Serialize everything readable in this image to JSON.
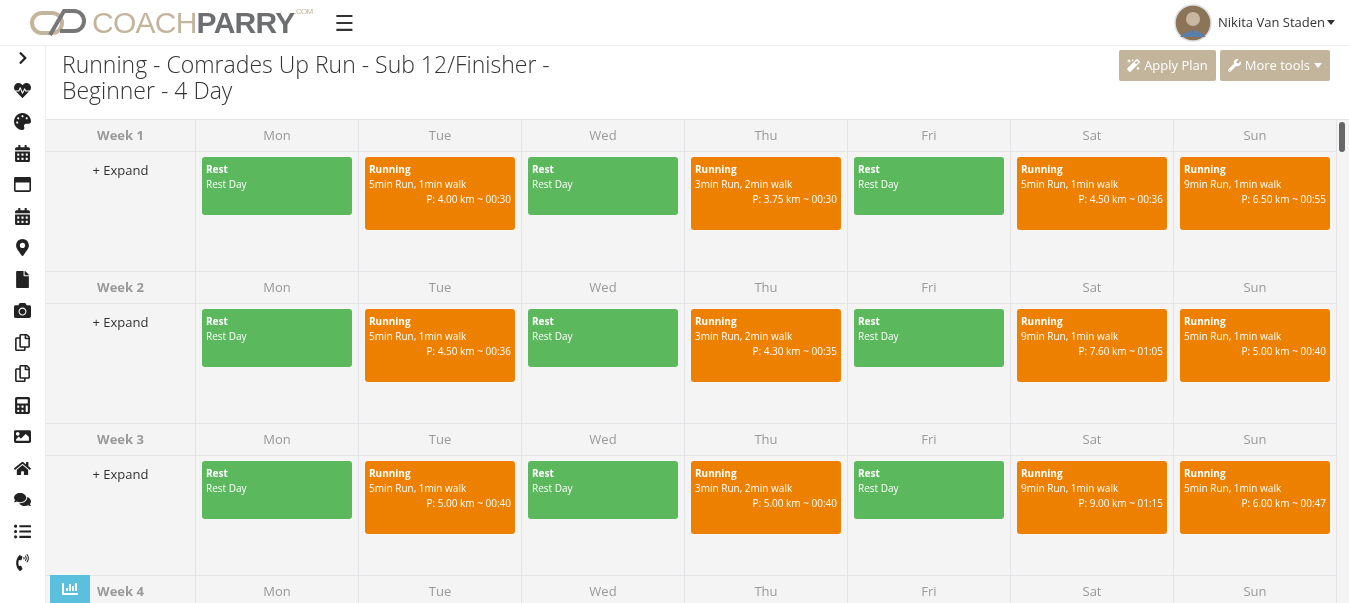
{
  "header": {
    "logo": {
      "left": "COACH",
      "right": "PARRY",
      "suffix": ".COM"
    },
    "menu_glyph": "☰",
    "user": {
      "name": "Nikita Van Staden"
    }
  },
  "plan": {
    "title": "Running - Comrades Up Run - Sub 12/Finisher - Beginner - 4 Day",
    "buttons": [
      {
        "label": "Apply Plan",
        "caret": false
      },
      {
        "label": "More tools",
        "caret": true
      }
    ]
  },
  "weeks": [
    {
      "label": "Week 1",
      "days": [
        "Mon",
        "Tue",
        "Wed",
        "Thu",
        "Fri",
        "Sat",
        "Sun"
      ],
      "expand": "+ Expand",
      "workouts": [
        {
          "kind": "rest",
          "title": "Rest",
          "detail": "Rest Day"
        },
        {
          "kind": "running",
          "title": "Running",
          "detail": "5min Run, 1min walk",
          "plan": "P: 4.00 km ~ 00:30"
        },
        {
          "kind": "rest",
          "title": "Rest",
          "detail": "Rest Day"
        },
        {
          "kind": "running",
          "title": "Running",
          "detail": "3min Run, 2min walk",
          "plan": "P: 3.75 km ~ 00:30"
        },
        {
          "kind": "rest",
          "title": "Rest",
          "detail": "Rest Day"
        },
        {
          "kind": "running",
          "title": "Running",
          "detail": "5min Run, 1min walk",
          "plan": "P: 4.50 km ~ 00:36"
        },
        {
          "kind": "running",
          "title": "Running",
          "detail": "9min Run, 1min walk",
          "plan": "P: 6.50 km ~ 00:55"
        }
      ]
    },
    {
      "label": "Week 2",
      "days": [
        "Mon",
        "Tue",
        "Wed",
        "Thu",
        "Fri",
        "Sat",
        "Sun"
      ],
      "expand": "+ Expand",
      "workouts": [
        {
          "kind": "rest",
          "title": "Rest",
          "detail": "Rest Day"
        },
        {
          "kind": "running",
          "title": "Running",
          "detail": "5min Run, 1min walk",
          "plan": "P: 4.50 km ~ 00:36"
        },
        {
          "kind": "rest",
          "title": "Rest",
          "detail": "Rest Day"
        },
        {
          "kind": "running",
          "title": "Running",
          "detail": "3min Run, 2min walk",
          "plan": "P: 4.30 km ~ 00:35"
        },
        {
          "kind": "rest",
          "title": "Rest",
          "detail": "Rest Day"
        },
        {
          "kind": "running",
          "title": "Running",
          "detail": "9min Run, 1min walk",
          "plan": "P: 7.60 km ~ 01:05"
        },
        {
          "kind": "running",
          "title": "Running",
          "detail": "5min Run, 1min walk",
          "plan": "P: 5.00 km ~ 00:40"
        }
      ]
    },
    {
      "label": "Week 3",
      "days": [
        "Mon",
        "Tue",
        "Wed",
        "Thu",
        "Fri",
        "Sat",
        "Sun"
      ],
      "expand": "+ Expand",
      "workouts": [
        {
          "kind": "rest",
          "title": "Rest",
          "detail": "Rest Day"
        },
        {
          "kind": "running",
          "title": "Running",
          "detail": "5min Run, 1min walk",
          "plan": "P: 5.00 km ~ 00:40"
        },
        {
          "kind": "rest",
          "title": "Rest",
          "detail": "Rest Day"
        },
        {
          "kind": "running",
          "title": "Running",
          "detail": "3min Run, 2min walk",
          "plan": "P: 5.00 km ~ 00:40"
        },
        {
          "kind": "rest",
          "title": "Rest",
          "detail": "Rest Day"
        },
        {
          "kind": "running",
          "title": "Running",
          "detail": "9min Run, 1min walk",
          "plan": "P: 9.00 km ~ 01:15"
        },
        {
          "kind": "running",
          "title": "Running",
          "detail": "5min Run, 1min walk",
          "plan": "P: 6.00 km ~ 00:47"
        }
      ]
    },
    {
      "label": "Week 4",
      "days": [
        "Mon",
        "Tue",
        "Wed",
        "Thu",
        "Fri",
        "Sat",
        "Sun"
      ]
    }
  ]
}
